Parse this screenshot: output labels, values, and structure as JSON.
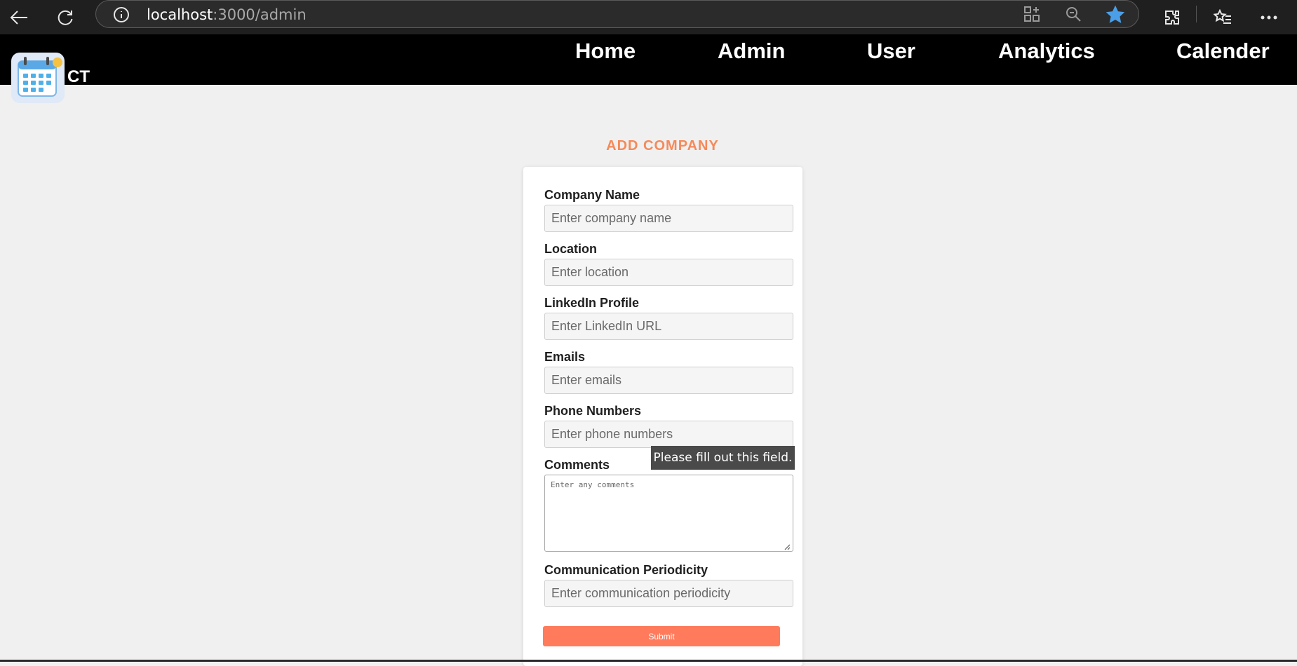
{
  "browser": {
    "url_host": "localhost",
    "url_path": ":3000/admin"
  },
  "site": {
    "brand": "CT",
    "nav": [
      "Home",
      "Admin",
      "User",
      "Analytics",
      "Calender"
    ]
  },
  "form": {
    "title": "ADD COMPANY",
    "fields": [
      {
        "label": "Company Name",
        "placeholder": "Enter company name"
      },
      {
        "label": "Location",
        "placeholder": "Enter location"
      },
      {
        "label": "LinkedIn Profile",
        "placeholder": "Enter LinkedIn URL"
      },
      {
        "label": "Emails",
        "placeholder": "Enter emails"
      },
      {
        "label": "Phone Numbers",
        "placeholder": "Enter phone numbers"
      },
      {
        "label": "Comments",
        "placeholder": "Enter any comments"
      },
      {
        "label": "Communication Periodicity",
        "placeholder": "Enter communication periodicity"
      }
    ],
    "submit_label": "Submit",
    "validation_tooltip": "Please fill out this field."
  },
  "colors": {
    "accent": "#f58a5a",
    "submit": "#ff7b5c",
    "navbar": "#000000"
  }
}
